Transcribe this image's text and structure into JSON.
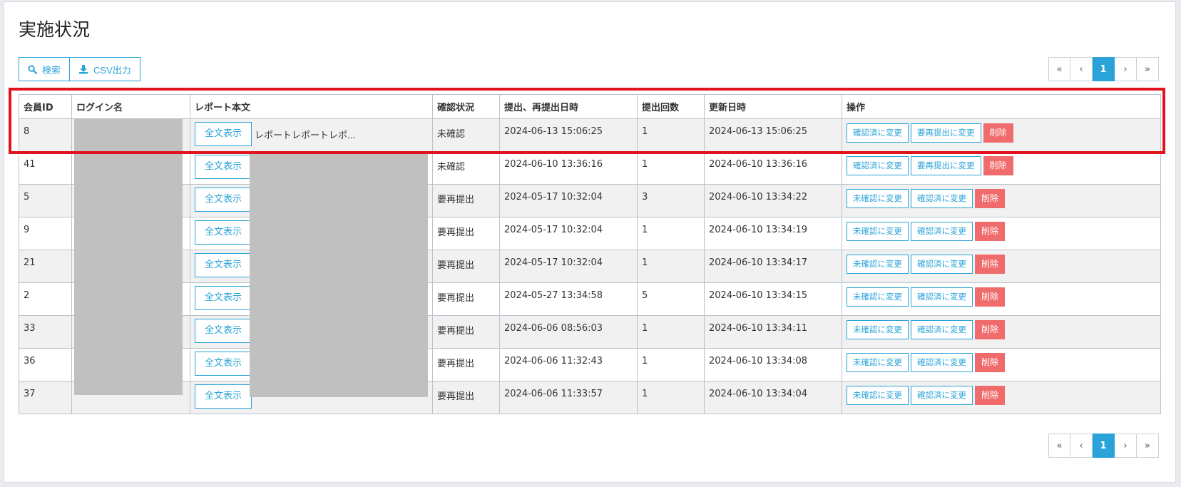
{
  "page": {
    "title": "実施状況"
  },
  "toolbar": {
    "search_label": "検索",
    "csv_label": "CSV出力"
  },
  "pagination": {
    "first": "«",
    "prev": "‹",
    "current": "1",
    "next": "›",
    "last": "»"
  },
  "table": {
    "headers": [
      "会員ID",
      "ログイン名",
      "レポート本文",
      "確認状況",
      "提出、再提出日時",
      "提出回数",
      "更新日時",
      "操作"
    ],
    "show_full_label": "全文表示",
    "delete_label": "削除",
    "rows": [
      {
        "id": "8",
        "excerpt": "レポートレポートレポ...",
        "status": "未確認",
        "submitted": "2024-06-13 15:06:25",
        "count": "1",
        "updated": "2024-06-13 15:06:25",
        "op1": "確認済に変更",
        "op2": "要再提出に変更"
      },
      {
        "id": "41",
        "excerpt": "",
        "status": "未確認",
        "submitted": "2024-06-10 13:36:16",
        "count": "1",
        "updated": "2024-06-10 13:36:16",
        "op1": "確認済に変更",
        "op2": "要再提出に変更"
      },
      {
        "id": "5",
        "excerpt": "",
        "status": "要再提出",
        "submitted": "2024-05-17 10:32:04",
        "count": "3",
        "updated": "2024-06-10 13:34:22",
        "op1": "未確認に変更",
        "op2": "確認済に変更"
      },
      {
        "id": "9",
        "excerpt": "",
        "status": "要再提出",
        "submitted": "2024-05-17 10:32:04",
        "count": "1",
        "updated": "2024-06-10 13:34:19",
        "op1": "未確認に変更",
        "op2": "確認済に変更"
      },
      {
        "id": "21",
        "excerpt": "",
        "status": "要再提出",
        "submitted": "2024-05-17 10:32:04",
        "count": "1",
        "updated": "2024-06-10 13:34:17",
        "op1": "未確認に変更",
        "op2": "確認済に変更"
      },
      {
        "id": "2",
        "excerpt": "",
        "status": "要再提出",
        "submitted": "2024-05-27 13:34:58",
        "count": "5",
        "updated": "2024-06-10 13:34:15",
        "op1": "未確認に変更",
        "op2": "確認済に変更"
      },
      {
        "id": "33",
        "excerpt": "",
        "status": "要再提出",
        "submitted": "2024-06-06 08:56:03",
        "count": "1",
        "updated": "2024-06-10 13:34:11",
        "op1": "未確認に変更",
        "op2": "確認済に変更"
      },
      {
        "id": "36",
        "excerpt": "",
        "status": "要再提出",
        "submitted": "2024-06-06 11:32:43",
        "count": "1",
        "updated": "2024-06-10 13:34:08",
        "op1": "未確認に変更",
        "op2": "確認済に変更"
      },
      {
        "id": "37",
        "excerpt": "",
        "status": "要再提出",
        "submitted": "2024-06-06 11:33:57",
        "count": "1",
        "updated": "2024-06-10 13:34:04",
        "op1": "未確認に変更",
        "op2": "確認済に変更"
      }
    ]
  },
  "colors": {
    "accent": "#29a3d8",
    "danger": "#f06b6b",
    "highlight": "#e0141e",
    "redaction": "#c0c0c0"
  },
  "icons": {
    "search": "search-icon",
    "download": "download-icon"
  }
}
